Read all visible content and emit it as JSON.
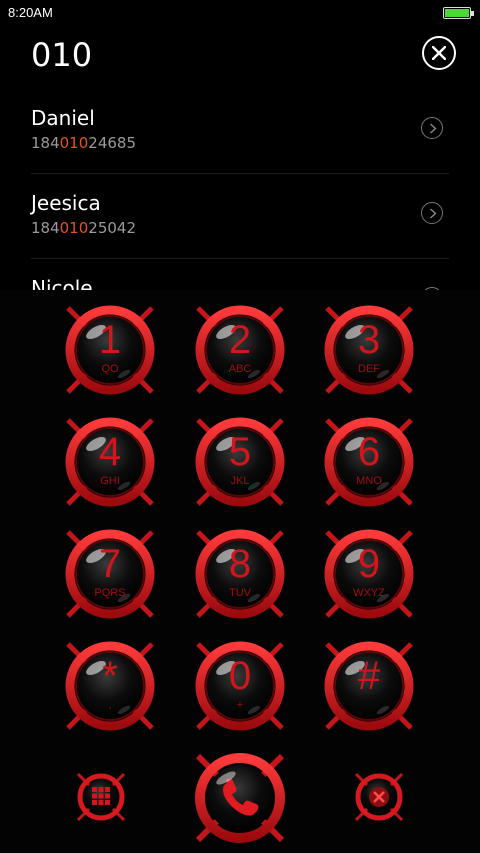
{
  "status_bar": {
    "time": "8:20AM",
    "battery_level": 1.0
  },
  "search": {
    "query": "010"
  },
  "contacts": [
    {
      "name": "Daniel",
      "number_prefix": "184",
      "number_match": "010",
      "number_suffix": "24685"
    },
    {
      "name": "Jeesica",
      "number_prefix": "184",
      "number_match": "010",
      "number_suffix": "25042"
    },
    {
      "name": "Nicole"
    }
  ],
  "keypad": {
    "keys": [
      {
        "digit": "1",
        "letters": "QO"
      },
      {
        "digit": "2",
        "letters": "ABC"
      },
      {
        "digit": "3",
        "letters": "DEF"
      },
      {
        "digit": "4",
        "letters": "GHI"
      },
      {
        "digit": "5",
        "letters": "JKL"
      },
      {
        "digit": "6",
        "letters": "MNO"
      },
      {
        "digit": "7",
        "letters": "PQRS"
      },
      {
        "digit": "8",
        "letters": "TUV"
      },
      {
        "digit": "9",
        "letters": "WXYZ"
      },
      {
        "digit": "*",
        "letters": ","
      },
      {
        "digit": "0",
        "letters": "+"
      },
      {
        "digit": "#",
        "letters": ""
      }
    ]
  },
  "actions": {
    "dialpad_icon": "grid-icon",
    "call_icon": "phone-icon",
    "delete_icon": "delete-icon"
  },
  "colors": {
    "accent": "#d4151b",
    "highlight": "#e4531f",
    "battery": "#4cd637"
  }
}
